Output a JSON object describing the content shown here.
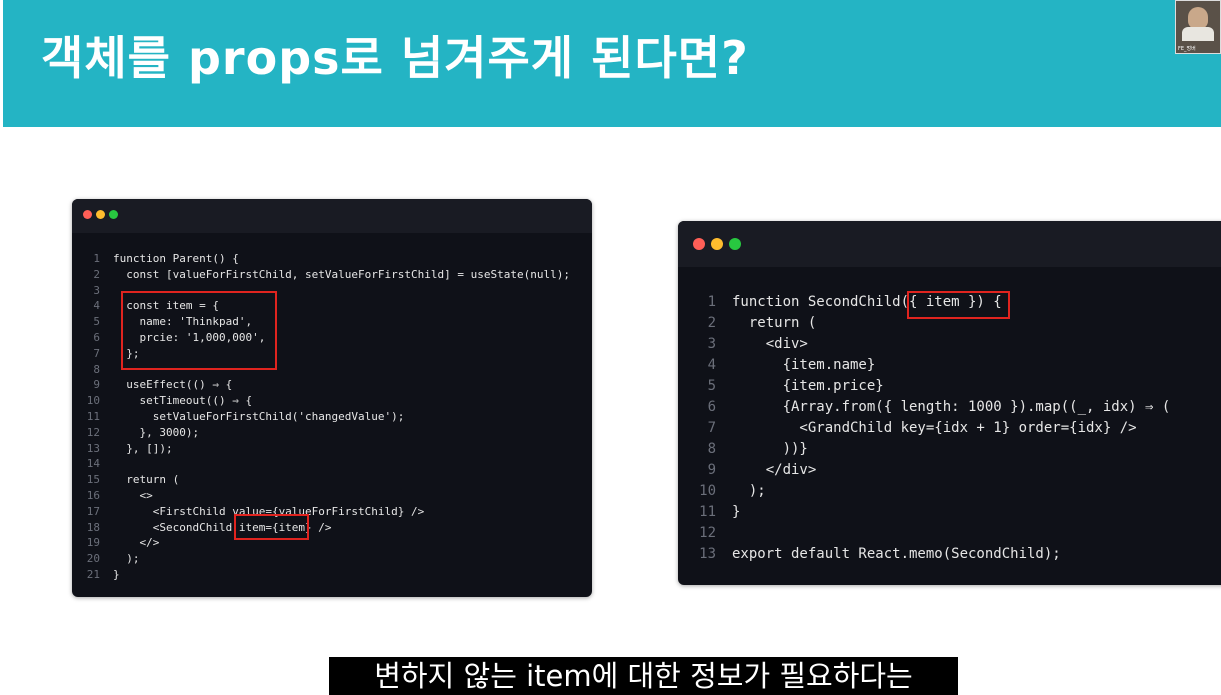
{
  "slide": {
    "title": "객체를 props로 넘겨주게 된다면?",
    "webcam_caption": "FE_멍버",
    "subtitle": "변하지 않는 item에 대한 정보가 필요하다는"
  },
  "left_code": {
    "lines": [
      {
        "no": "1",
        "text": "function Parent() {"
      },
      {
        "no": "2",
        "text": "  const [valueForFirstChild, setValueForFirstChild] = useState(null);"
      },
      {
        "no": "3",
        "text": ""
      },
      {
        "no": "4",
        "text": "  const item = {"
      },
      {
        "no": "5",
        "text": "    name: 'Thinkpad',"
      },
      {
        "no": "6",
        "text": "    prcie: '1,000,000',"
      },
      {
        "no": "7",
        "text": "  };"
      },
      {
        "no": "8",
        "text": ""
      },
      {
        "no": "9",
        "text": "  useEffect(() ⇒ {"
      },
      {
        "no": "10",
        "text": "    setTimeout(() ⇒ {"
      },
      {
        "no": "11",
        "text": "      setValueForFirstChild('changedValue');"
      },
      {
        "no": "12",
        "text": "    }, 3000);"
      },
      {
        "no": "13",
        "text": "  }, []);"
      },
      {
        "no": "14",
        "text": ""
      },
      {
        "no": "15",
        "text": "  return ("
      },
      {
        "no": "16",
        "text": "    <>"
      },
      {
        "no": "17",
        "text": "      <FirstChild value={valueForFirstChild} />"
      },
      {
        "no": "18",
        "text": "      <SecondChild item={item} />"
      },
      {
        "no": "19",
        "text": "    </>"
      },
      {
        "no": "20",
        "text": "  );"
      },
      {
        "no": "21",
        "text": "}"
      }
    ]
  },
  "right_code": {
    "lines": [
      {
        "no": "1",
        "text": "function SecondChild({ item }) {"
      },
      {
        "no": "2",
        "text": "  return ("
      },
      {
        "no": "3",
        "text": "    <div>"
      },
      {
        "no": "4",
        "text": "      {item.name}"
      },
      {
        "no": "5",
        "text": "      {item.price}"
      },
      {
        "no": "6",
        "text": "      {Array.from({ length: 1000 }).map((_, idx) ⇒ ("
      },
      {
        "no": "7",
        "text": "        <GrandChild key={idx + 1} order={idx} />"
      },
      {
        "no": "8",
        "text": "      ))}"
      },
      {
        "no": "9",
        "text": "    </div>"
      },
      {
        "no": "10",
        "text": "  );"
      },
      {
        "no": "11",
        "text": "}"
      },
      {
        "no": "12",
        "text": ""
      },
      {
        "no": "13",
        "text": "export default React.memo(SecondChild);"
      }
    ]
  },
  "colors": {
    "banner": "#24b4c4",
    "editor_bg": "#0f1118",
    "highlight_box": "#e0241f",
    "dot_red": "#ff5f57",
    "dot_yellow": "#febc2e",
    "dot_green": "#28c840"
  }
}
